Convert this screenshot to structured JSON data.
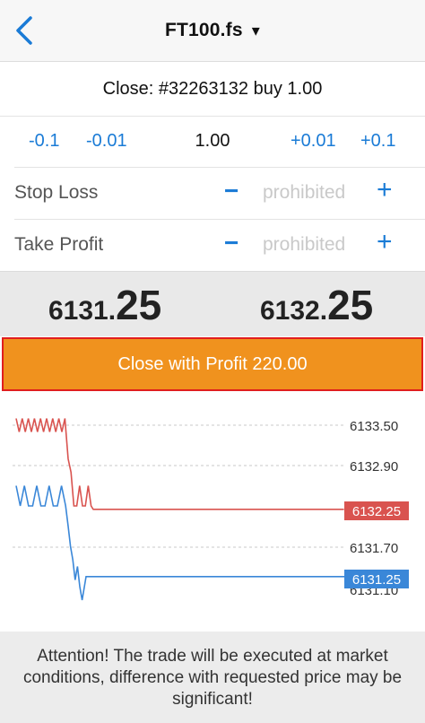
{
  "header": {
    "title": "FT100.fs",
    "caret": "▾"
  },
  "order": {
    "close_text": "Close: #32263132 buy 1.00"
  },
  "volume": {
    "minus_big": "-0.1",
    "minus_small": "-0.01",
    "value": "1.00",
    "plus_small": "+0.01",
    "plus_big": "+0.1"
  },
  "stop_loss": {
    "label": "Stop Loss",
    "minus": "−",
    "value": "prohibited",
    "plus": "+"
  },
  "take_profit": {
    "label": "Take Profit",
    "minus": "−",
    "value": "prohibited",
    "plus": "+"
  },
  "prices": {
    "bid": {
      "main": "6131.",
      "big": "25"
    },
    "ask": {
      "main": "6132.",
      "big": "25"
    }
  },
  "close_button": {
    "label": "Close with Profit 220.00"
  },
  "chart": {
    "levels": [
      "6133.50",
      "6132.90",
      "6132.25",
      "6131.70",
      "6131.25",
      "6131.10"
    ],
    "bid_tag": "6131.25",
    "ask_tag": "6132.25",
    "colors": {
      "ask": "#d9534f",
      "bid": "#3a87d8",
      "grid": "#c8c8c8"
    }
  },
  "chart_data": {
    "type": "line",
    "series": [
      {
        "values": [
          6133.6,
          6133.4,
          6133.6,
          6133.4,
          6133.6,
          6133.4,
          6133.6,
          6133.4,
          6133.6,
          6133.4,
          6133.6,
          6133.4,
          6133.6,
          6133.4,
          6133.6,
          6133.4,
          6133.6,
          6133.0,
          6132.8,
          6132.3,
          6132.3,
          6132.6,
          6132.3,
          6132.3,
          6132.6,
          6132.3,
          6132.25,
          6132.25,
          6132.25,
          6132.25,
          6132.25,
          6132.25,
          6132.25
        ]
      },
      {
        "values": [
          6132.6,
          6132.3,
          6132.6,
          6132.3,
          6132.3,
          6132.6,
          6132.3,
          6132.3,
          6132.6,
          6132.3,
          6132.3,
          6132.6,
          6132.3,
          6132.0,
          6131.7,
          6131.5,
          6131.2,
          6131.4,
          6131.1,
          6130.9,
          6131.25,
          6131.25,
          6131.25,
          6131.25,
          6131.25,
          6131.25,
          6131.25
        ]
      }
    ]
  },
  "attention": {
    "text": "Attention! The trade will be executed at market conditions, difference with requested price may be significant!"
  }
}
